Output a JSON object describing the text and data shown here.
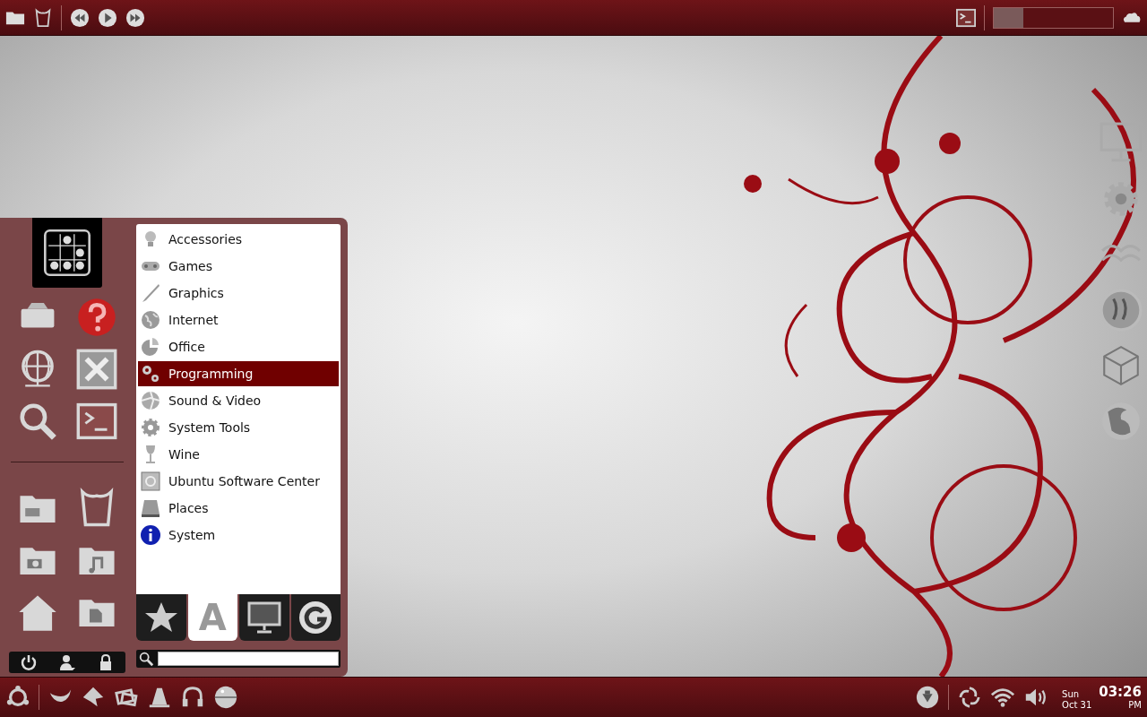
{
  "top_panel": {
    "meter": {
      "level": 0.25
    }
  },
  "menu": {
    "categories": [
      {
        "label": "Accessories",
        "selected": false
      },
      {
        "label": "Games",
        "selected": false
      },
      {
        "label": "Graphics",
        "selected": false
      },
      {
        "label": "Internet",
        "selected": false
      },
      {
        "label": "Office",
        "selected": false
      },
      {
        "label": "Programming",
        "selected": true
      },
      {
        "label": "Sound & Video",
        "selected": false
      },
      {
        "label": "System Tools",
        "selected": false
      },
      {
        "label": "Wine",
        "selected": false
      },
      {
        "label": "Ubuntu Software Center",
        "selected": false
      },
      {
        "label": "Places",
        "selected": false
      },
      {
        "label": "System",
        "selected": false
      }
    ],
    "tabs": [
      {
        "kind": "icon",
        "selected": false
      },
      {
        "kind": "text",
        "label": "A",
        "selected": true
      },
      {
        "kind": "icon",
        "selected": false
      },
      {
        "kind": "icon",
        "selected": false
      }
    ]
  },
  "clock": {
    "day": "Sun",
    "date": "Oct 31",
    "time": "03:26",
    "period": "PM"
  }
}
